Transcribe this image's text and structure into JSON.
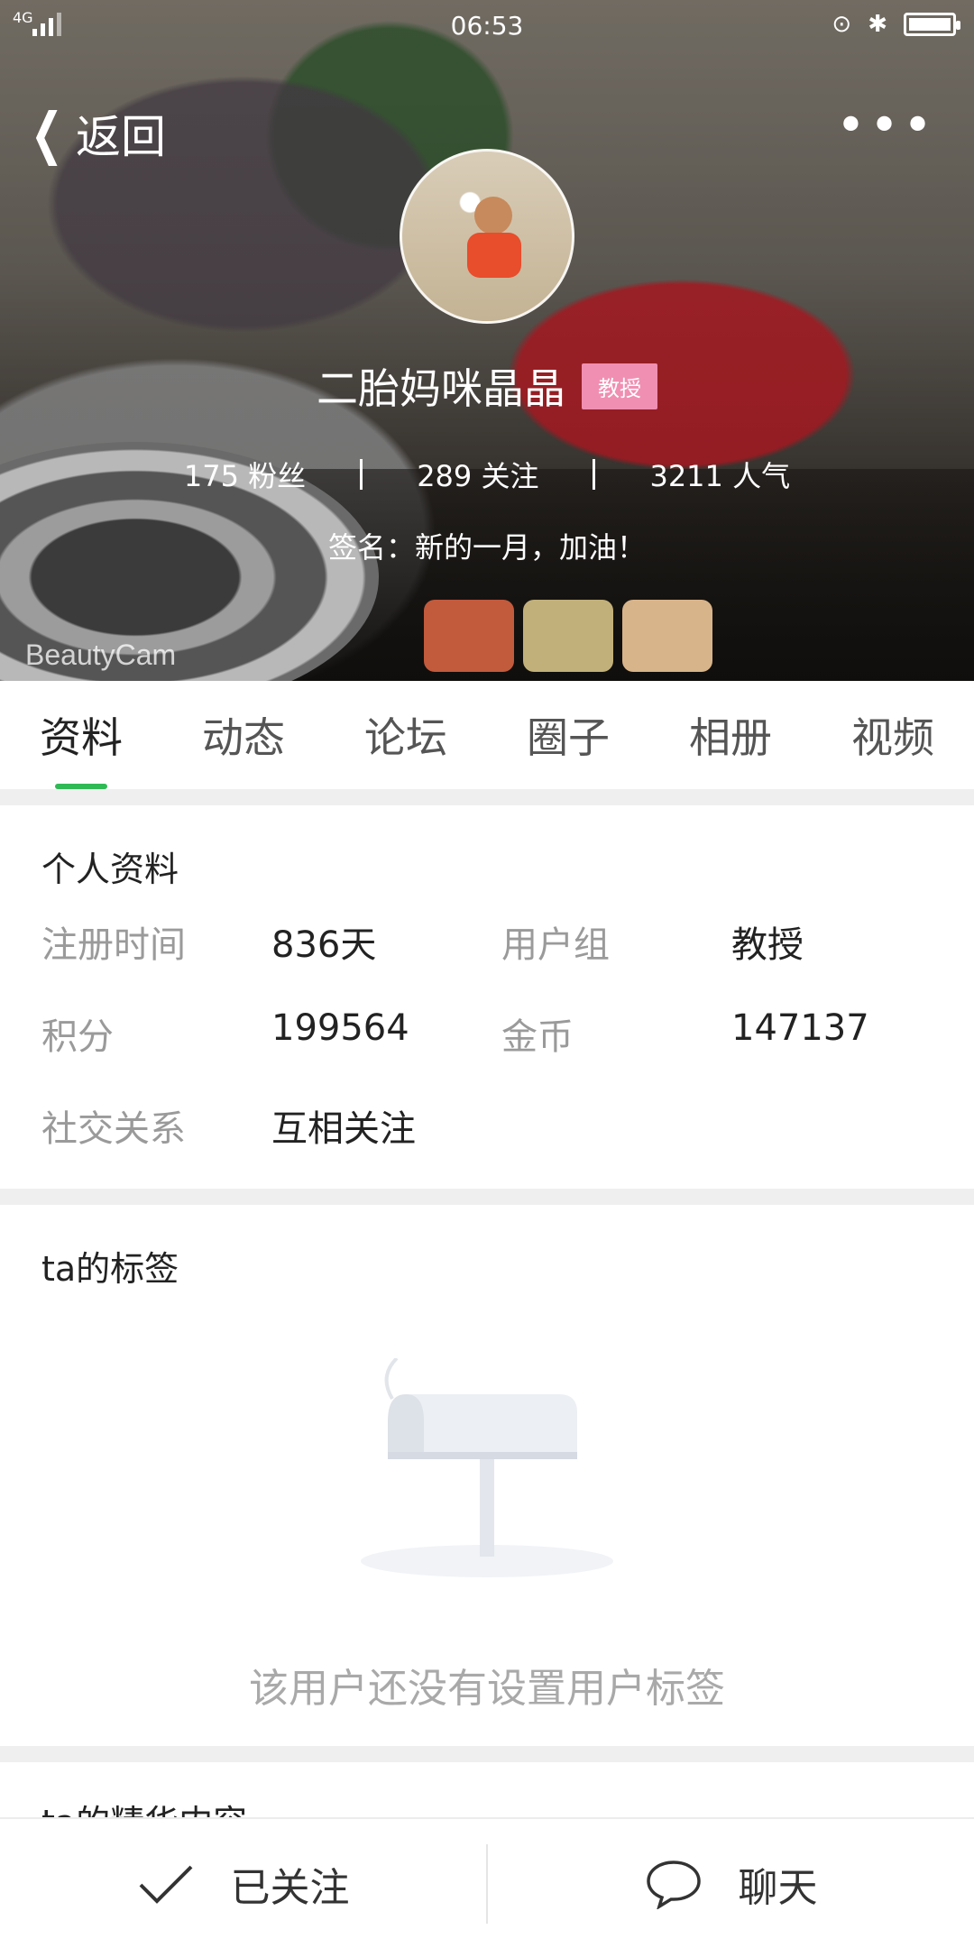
{
  "status_bar": {
    "network": "4G",
    "time": "06:53"
  },
  "header": {
    "back_label": "返回",
    "more_label": "•••",
    "user_name": "二胎妈咪晶晶",
    "user_badge": "教授",
    "stats": [
      {
        "text": "175 粉丝"
      },
      {
        "text": "289 关注"
      },
      {
        "text": "3211 人气"
      }
    ],
    "signature": "签名：新的一月，加油！",
    "watermark": "BeautyCam"
  },
  "tabs": [
    "资料",
    "动态",
    "论坛",
    "圈子",
    "相册",
    "视频"
  ],
  "profile": {
    "title": "个人资料",
    "rows": [
      {
        "l1": "注册时间",
        "v1": "836天",
        "l2": "用户组",
        "v2": "教授"
      },
      {
        "l1": "积分",
        "v1": "199564",
        "l2": "金币",
        "v2": "147137"
      },
      {
        "l1": "社交关系",
        "v1": "互相关注",
        "l2": "",
        "v2": ""
      }
    ]
  },
  "tags": {
    "title": "ta的标签",
    "empty_text": "该用户还没有设置用户标签"
  },
  "featured": {
    "title": "ta的精华内容"
  },
  "bottom_bar": {
    "follow_label": "已关注",
    "chat_label": "聊天"
  },
  "colors": {
    "accent": "#2fba55",
    "badge": "#f08fb2"
  }
}
